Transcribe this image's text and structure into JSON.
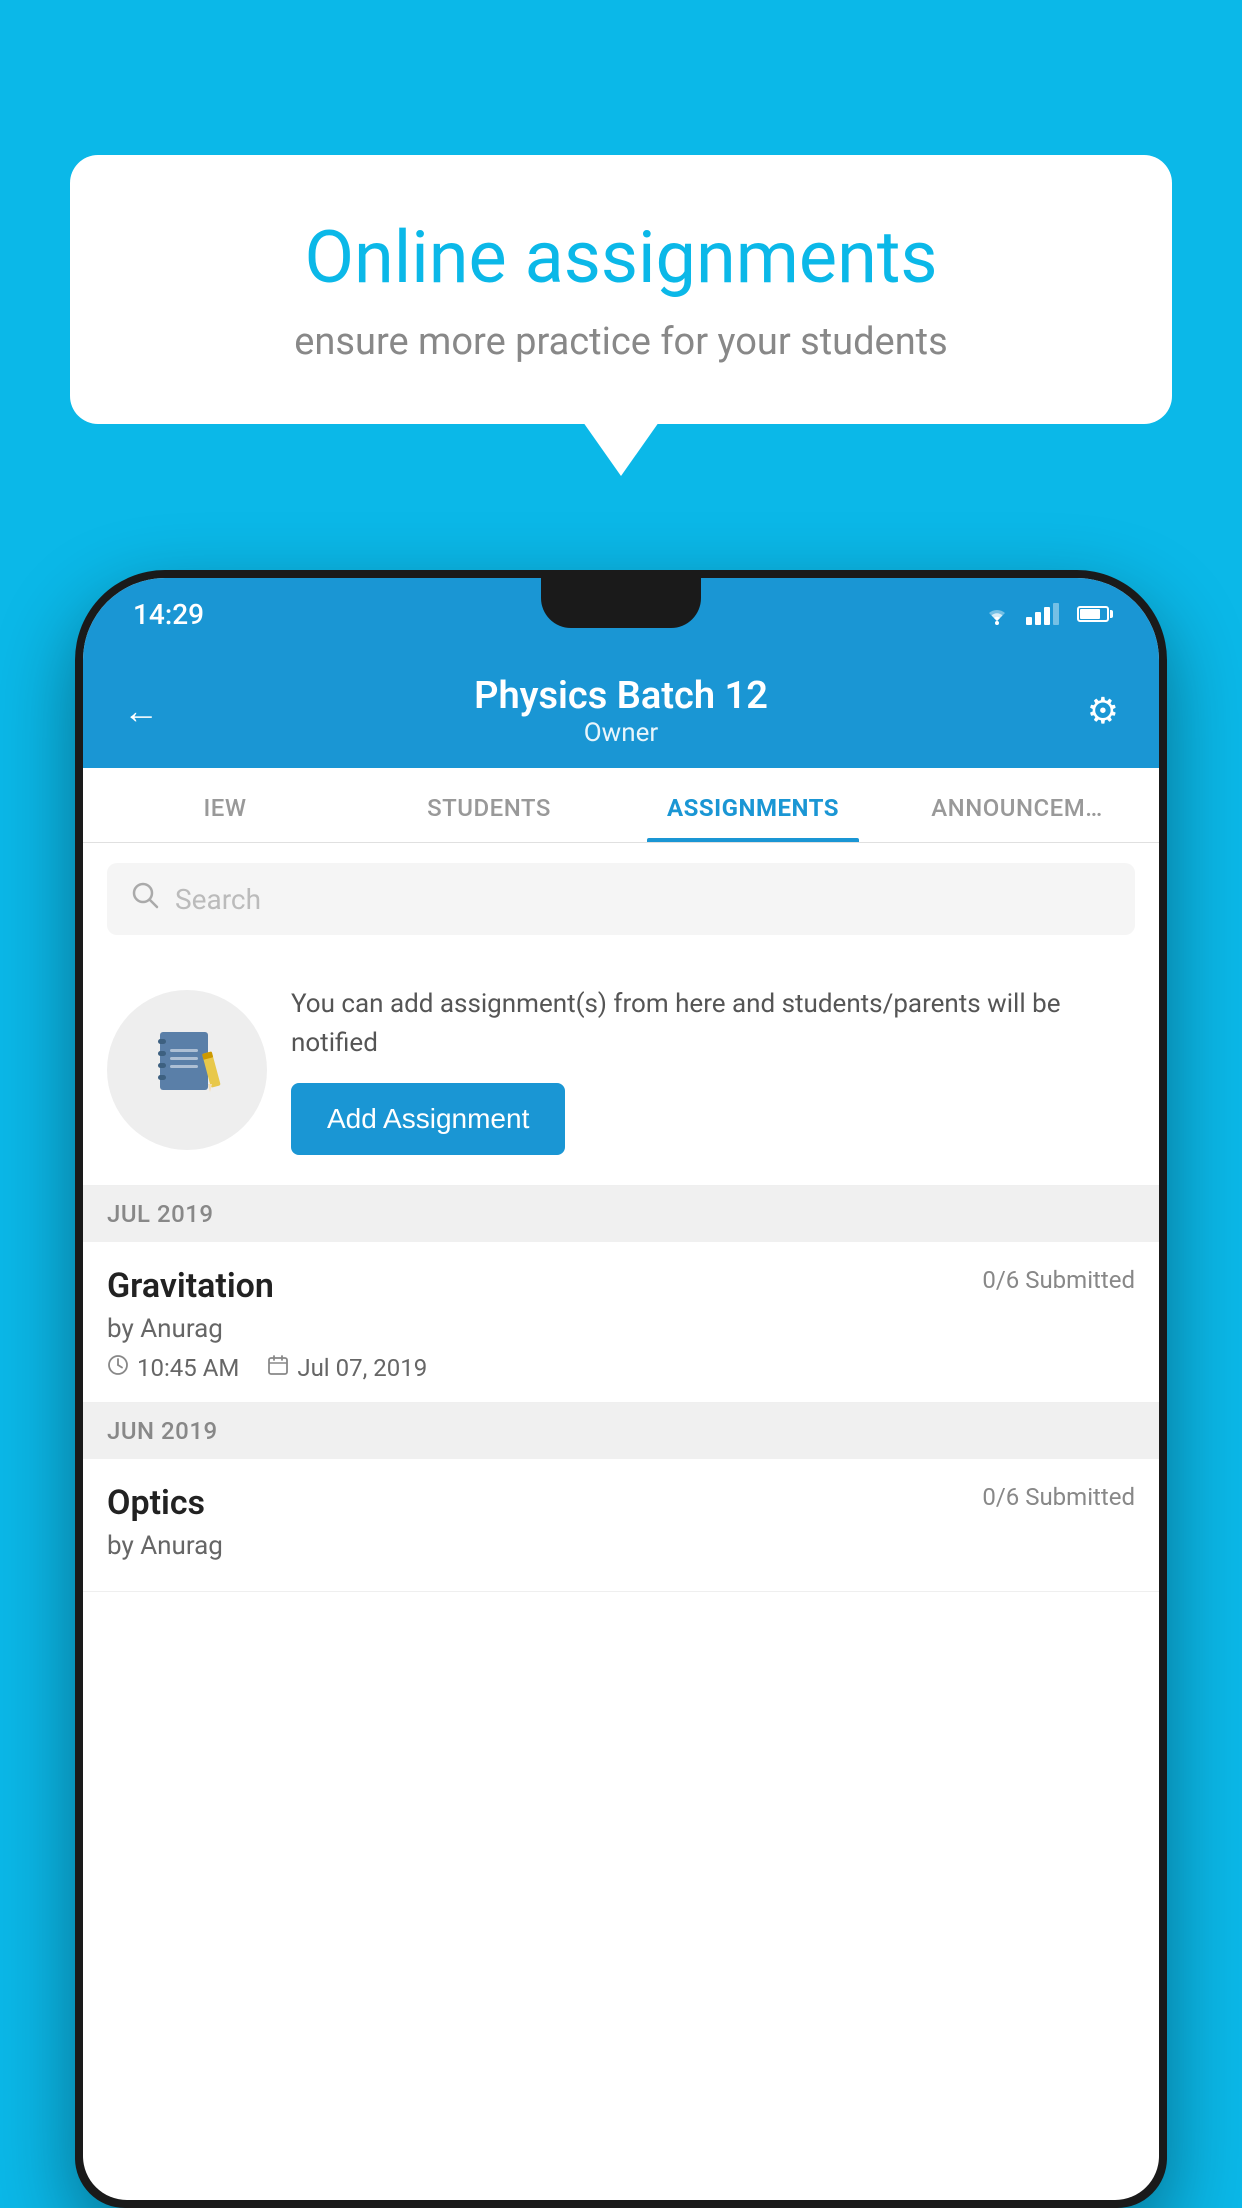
{
  "background": {
    "color": "#0bb8e8"
  },
  "speech_bubble": {
    "title": "Online assignments",
    "subtitle": "ensure more practice for your students"
  },
  "status_bar": {
    "time": "14:29"
  },
  "header": {
    "title": "Physics Batch 12",
    "subtitle": "Owner",
    "back_label": "←",
    "settings_label": "⚙"
  },
  "tabs": [
    {
      "label": "IEW",
      "active": false
    },
    {
      "label": "STUDENTS",
      "active": false
    },
    {
      "label": "ASSIGNMENTS",
      "active": true
    },
    {
      "label": "ANNOUNCEM…",
      "active": false
    }
  ],
  "search": {
    "placeholder": "Search"
  },
  "promo": {
    "description": "You can add assignment(s) from here and students/parents will be notified",
    "button_label": "Add Assignment"
  },
  "sections": [
    {
      "header": "JUL 2019",
      "items": [
        {
          "name": "Gravitation",
          "submitted": "0/6 Submitted",
          "by": "by Anurag",
          "time": "10:45 AM",
          "date": "Jul 07, 2019"
        }
      ]
    },
    {
      "header": "JUN 2019",
      "items": [
        {
          "name": "Optics",
          "submitted": "0/6 Submitted",
          "by": "by Anurag",
          "time": "",
          "date": ""
        }
      ]
    }
  ]
}
